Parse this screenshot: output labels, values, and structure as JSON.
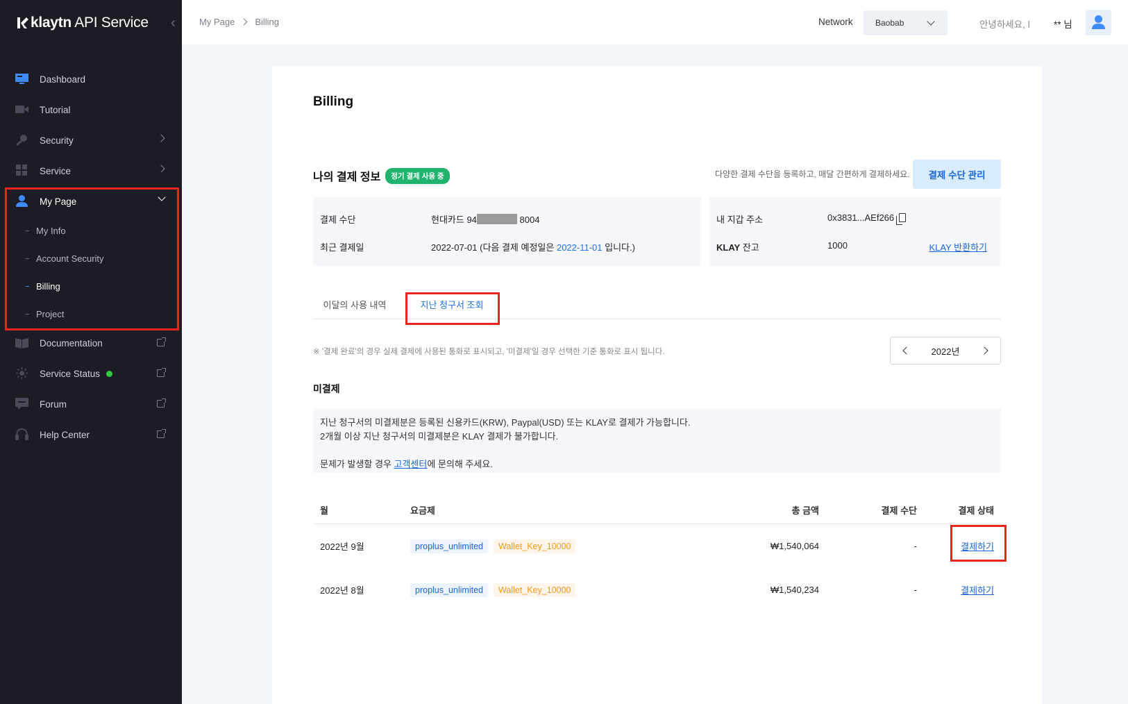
{
  "sidebar": {
    "logo_brand": "klaytn",
    "logo_product": "API Service",
    "items": [
      {
        "label": "Dashboard",
        "icon": "monitor-icon"
      },
      {
        "label": "Tutorial",
        "icon": "video-camera-icon"
      },
      {
        "label": "Security",
        "icon": "key-icon"
      },
      {
        "label": "Service",
        "icon": "grid-icon"
      },
      {
        "label": "My Page",
        "icon": "user-icon"
      },
      {
        "label": "Documentation",
        "icon": "book-icon"
      },
      {
        "label": "Service Status",
        "icon": "sun-status-icon"
      },
      {
        "label": "Forum",
        "icon": "chat-icon"
      },
      {
        "label": "Help Center",
        "icon": "headset-icon"
      }
    ],
    "subitems": [
      {
        "label": "My Info"
      },
      {
        "label": "Account Security"
      },
      {
        "label": "Billing"
      },
      {
        "label": "Project"
      }
    ],
    "accent": "#3d8bff",
    "status_color": "#2ecc40"
  },
  "header": {
    "breadcrumb": [
      "My Page",
      "Billing"
    ],
    "network_label": "Network",
    "network_value": "Baobab",
    "greeting": "안녕하세요, l",
    "user_name": "** 님"
  },
  "main": {
    "title": "Billing",
    "payment_info": {
      "title": "나의 결제 정보",
      "badge": "정기 결제 사용 중",
      "description": "다양한 결제 수단을 등록하고, 매달 간편하게 결제하세요.",
      "manage_button": "결제 수단 관리",
      "method_label": "결제 수단",
      "method_prefix": "현대카드 94",
      "method_suffix": " 8004",
      "recent_label": "최근 결제일",
      "recent_date": "2022-07-01 (다음 결제 예정일은 ",
      "next_date": "2022-11-01",
      "recent_tail": " 입니다.)",
      "wallet_label": "내 지갑 주소",
      "wallet_address": "0x3831...AEf266",
      "klay_label_bold": "KLAY",
      "klay_label_rest": " 잔고",
      "klay_balance": "1000",
      "klay_return_link": "KLAY 반환하기"
    },
    "tabs": [
      {
        "label": "이달의 사용 내역"
      },
      {
        "label": "지난 청구서 조회"
      }
    ],
    "note": "※ '결제 완료'의 경우 실제 결제에 사용된 통화로 표시되고, '미결제'일 경우 선택한 기준 통화로 표시 됩니다.",
    "year": "2022년",
    "unpaid": {
      "title": "미결제",
      "line1": "지난 청구서의 미결제분은 등록된 신용카드(KRW), Paypal(USD) 또는 KLAY로 결제가 가능합니다.",
      "line2": "2개월 이상 지난 청구서의 미결제분은 KLAY 결제가 불가합니다.",
      "line3_prefix": "문제가 발생할 경우 ",
      "line3_link": "고객센터",
      "line3_suffix": "에 문의해 주세요."
    },
    "table": {
      "headers": {
        "month": "월",
        "plan": "요금제",
        "total": "총 금액",
        "method": "결제 수단",
        "status": "결제 상태"
      },
      "rows": [
        {
          "month": "2022년 9월",
          "plan1": "proplus_unlimited",
          "plan2": "Wallet_Key_10000",
          "total": "₩1,540,064",
          "method": "-",
          "status": "결제하기"
        },
        {
          "month": "2022년 8월",
          "plan1": "proplus_unlimited",
          "plan2": "Wallet_Key_10000",
          "total": "₩1,540,234",
          "method": "-",
          "status": "결제하기"
        }
      ]
    }
  },
  "colors": {
    "sidebar_bg": "#1c1c24",
    "link_blue": "#1a66d8",
    "badge_green": "#1fb36b",
    "highlight_red": "#e8261d"
  }
}
